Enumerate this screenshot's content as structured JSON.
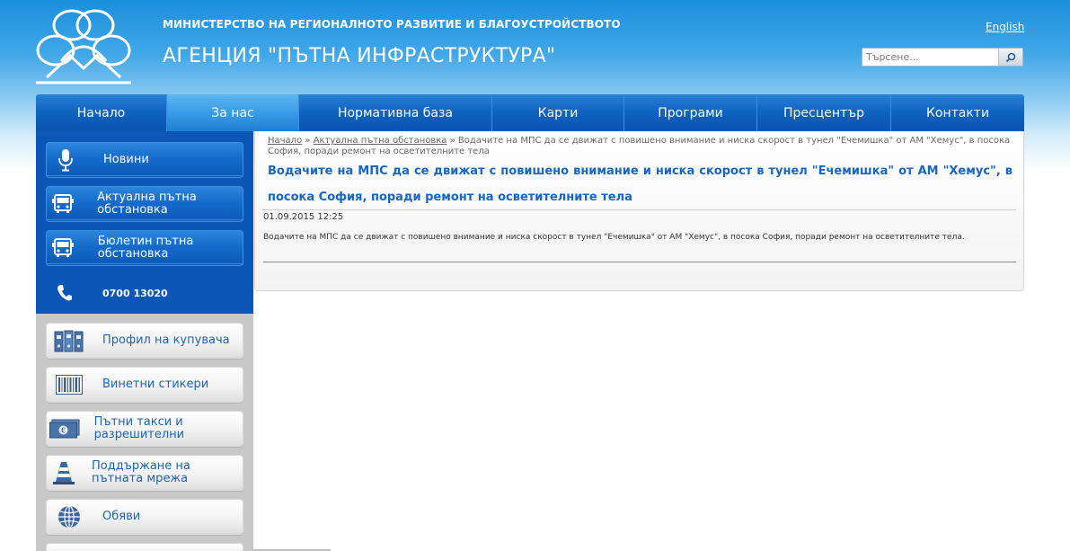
{
  "header": {
    "subtitle": "МИНИСТЕРСТВО НА РЕГИОНАЛНОТО РАЗВИТИЕ И БЛАГОУСТРОЙСТВОТО",
    "title": "АГЕНЦИЯ \"ПЪТНА ИНФРАСТРУКТУРА\"",
    "language_link": "English",
    "search": {
      "placeholder": "Търсене..."
    }
  },
  "nav": {
    "items": [
      {
        "label": "Начало",
        "active": false
      },
      {
        "label": "За нас",
        "active": true
      },
      {
        "label": "Нормативна база",
        "active": false
      },
      {
        "label": "Карти",
        "active": false
      },
      {
        "label": "Програми",
        "active": false
      },
      {
        "label": "Пресцентър",
        "active": false
      },
      {
        "label": "Контакти",
        "active": false
      }
    ]
  },
  "sidebar": {
    "primary": [
      {
        "label": "Новини",
        "icon": "microphone-icon"
      },
      {
        "label": "Актуална пътна обстановка",
        "icon": "bus-icon"
      },
      {
        "label": "Бюлетин пътна обстановка",
        "icon": "bus-icon"
      }
    ],
    "phone": {
      "label": "0700 13020",
      "icon": "phone-icon"
    },
    "secondary": [
      {
        "label": "Профил на купувача",
        "icon": "binders-icon"
      },
      {
        "label": "Винетни стикери",
        "icon": "barcode-icon"
      },
      {
        "label": "Пътни такси и разрешителни",
        "icon": "banknote-icon"
      },
      {
        "label": "Поддържане на пътната мрежа",
        "icon": "traffic-cone-icon"
      },
      {
        "label": "Обяви",
        "icon": "globe-icon"
      }
    ]
  },
  "content": {
    "breadcrumb": {
      "home": "Начало",
      "separator": "»",
      "section": "Актуална пътна обстановка",
      "current": "Водачите на МПС да се движат с повишено внимание и ниска скорост в тунел \"Ечемишка\" от АМ \"Хемус\", в посока София, поради ремонт на осветителните тела"
    },
    "title": "Водачите на МПС да се движат с повишено внимание и ниска скорост в тунел \"Ечемишка\" от АМ \"Хемус\", в посока София, поради ремонт на осветителните тела",
    "date": "01.09.2015 12:25",
    "body": "Водачите на МПС да се движат с повишено внимание и ниска скорост в тунел \"Ечемишка\" от АМ \"Хемус\", в посока София, поради ремонт на осветителните тела."
  },
  "colors": {
    "nav_blue": "#0e62c0",
    "nav_active": "#3a9be6",
    "sidebar_blue": "#0b56b6",
    "link_blue": "#1866c4",
    "sidebar_gray": "#c8c8c8"
  }
}
